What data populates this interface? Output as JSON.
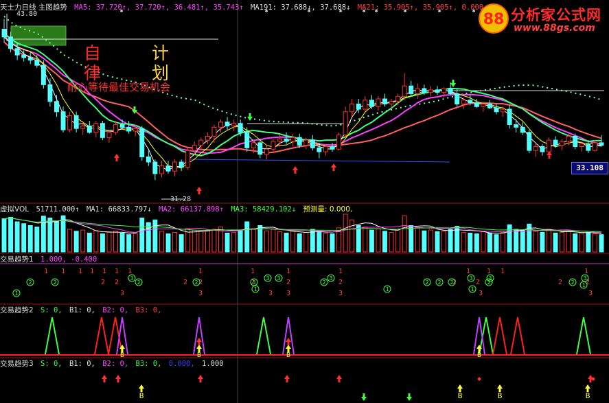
{
  "header_main": {
    "title": "天士力日线  主图趋势",
    "ma5": "MA5: 37.720↑, 37.720↑, 36.481↑, 35.743↑",
    "ma191": "MA191: 37.688↓, 37.688↓",
    "ma21": "MA21: 35.905↑, 35.905↑, 0.000,"
  },
  "price": {
    "high_label": "43.80",
    "low_label": "31.28",
    "last_tag": "33.108"
  },
  "annotations": {
    "zi_lv": [
      "自",
      "律"
    ],
    "ji_hua": [
      "计",
      "划"
    ],
    "note": "耐心等待最佳交易机会"
  },
  "logo": {
    "name": "分析家公式网",
    "url": "www.88gs.com"
  },
  "header_vol": {
    "title": "虚拟VOL",
    "vol": "51711.000↑",
    "ma1": "MA1: 66833.797↓",
    "ma2": "MA2: 66137.898↑",
    "ma3": "MA3: 58429.102↓",
    "pred": "预测量: 0.000,"
  },
  "header_t1": {
    "title": "交易趋势1",
    "values": "1.000, -0.400"
  },
  "header_t2": {
    "title": "交易趋势2",
    "s": "S: 0,",
    "b1": "B1: 0,",
    "b2": "B2: 0,",
    "b3": "B3: 0,"
  },
  "header_t3": {
    "title": "交易趋势3",
    "s": "S: 0,",
    "b1": "B1: 0,",
    "b2": "B2: 0,",
    "b3": "B3: 0,",
    "extra1": "0.000,",
    "extra2": "1.000"
  },
  "colors": {
    "up": "#ff3030",
    "down": "#54ffff",
    "ma_fast": "#ffffff",
    "ma_mid": "#ffff00",
    "ma_slow": "#ff40ff",
    "ma_green": "#40ff80",
    "ma_orange": "#ff6060",
    "dotted": "#80ffb0"
  },
  "candles": [
    [
      43.0,
      43.8,
      42.0,
      42.4
    ],
    [
      42.4,
      42.8,
      41.2,
      41.5
    ],
    [
      41.5,
      42.0,
      40.6,
      41.0
    ],
    [
      41.0,
      41.5,
      40.5,
      40.8
    ],
    [
      40.8,
      41.3,
      40.3,
      40.6
    ],
    [
      40.6,
      41.0,
      40.0,
      40.2
    ],
    [
      40.2,
      40.6,
      38.4,
      38.7
    ],
    [
      38.7,
      39.2,
      37.0,
      37.4
    ],
    [
      37.4,
      37.9,
      36.2,
      36.6
    ],
    [
      36.6,
      37.0,
      35.0,
      35.2
    ],
    [
      35.2,
      36.6,
      35.0,
      36.3
    ],
    [
      36.3,
      36.6,
      35.0,
      35.3
    ],
    [
      35.3,
      35.9,
      34.8,
      35.5
    ],
    [
      35.5,
      35.9,
      34.9,
      35.0
    ],
    [
      35.0,
      35.9,
      34.6,
      35.7
    ],
    [
      35.7,
      35.9,
      34.4,
      34.6
    ],
    [
      34.6,
      35.2,
      34.2,
      35.0
    ],
    [
      35.0,
      35.9,
      34.8,
      35.6
    ],
    [
      35.6,
      36.0,
      35.2,
      35.4
    ],
    [
      35.4,
      35.9,
      34.9,
      35.1
    ],
    [
      35.1,
      35.6,
      34.7,
      35.3
    ],
    [
      35.3,
      35.5,
      32.8,
      33.1
    ],
    [
      33.1,
      33.6,
      32.4,
      32.7
    ],
    [
      32.7,
      32.9,
      31.3,
      31.8
    ],
    [
      31.8,
      32.8,
      31.5,
      32.4
    ],
    [
      32.4,
      32.8,
      31.8,
      32.0
    ],
    [
      32.0,
      32.9,
      31.6,
      32.7
    ],
    [
      32.7,
      32.9,
      32.0,
      32.3
    ],
    [
      32.3,
      33.8,
      32.1,
      33.6
    ],
    [
      33.6,
      34.3,
      33.2,
      34.0
    ],
    [
      34.0,
      34.6,
      33.6,
      34.4
    ],
    [
      34.4,
      35.0,
      34.1,
      34.7
    ],
    [
      34.7,
      35.6,
      34.2,
      35.4
    ],
    [
      35.4,
      36.0,
      35.0,
      35.8
    ],
    [
      35.8,
      36.2,
      35.2,
      35.5
    ],
    [
      35.5,
      36.0,
      35.1,
      35.7
    ],
    [
      35.7,
      36.0,
      34.7,
      35.0
    ],
    [
      35.0,
      35.4,
      33.5,
      33.8
    ],
    [
      33.8,
      34.4,
      33.4,
      34.2
    ],
    [
      34.2,
      34.5,
      33.0,
      33.3
    ],
    [
      33.3,
      34.0,
      32.9,
      33.7
    ],
    [
      33.7,
      34.5,
      33.5,
      34.3
    ],
    [
      34.3,
      34.8,
      33.9,
      34.5
    ],
    [
      34.5,
      35.0,
      34.1,
      34.3
    ],
    [
      34.3,
      34.9,
      33.9,
      34.6
    ],
    [
      34.6,
      34.9,
      33.8,
      34.0
    ],
    [
      34.0,
      34.6,
      33.7,
      34.4
    ],
    [
      34.4,
      34.8,
      33.6,
      33.8
    ],
    [
      33.8,
      34.2,
      33.0,
      33.5
    ],
    [
      33.5,
      34.0,
      33.2,
      33.9
    ],
    [
      33.9,
      34.2,
      33.5,
      33.7
    ],
    [
      33.7,
      35.0,
      33.6,
      34.8
    ],
    [
      34.8,
      37.0,
      34.6,
      36.6
    ],
    [
      36.6,
      37.6,
      36.2,
      37.2
    ],
    [
      37.2,
      37.6,
      36.5,
      36.8
    ],
    [
      36.8,
      37.8,
      36.6,
      37.5
    ],
    [
      37.5,
      37.9,
      36.8,
      37.0
    ],
    [
      37.0,
      37.8,
      36.7,
      37.6
    ],
    [
      37.6,
      38.0,
      37.0,
      37.2
    ],
    [
      37.2,
      37.6,
      36.8,
      37.4
    ],
    [
      37.4,
      38.0,
      37.1,
      37.8
    ],
    [
      37.8,
      39.6,
      37.5,
      38.6
    ],
    [
      38.6,
      39.0,
      37.8,
      38.0
    ],
    [
      38.0,
      38.8,
      37.6,
      38.4
    ],
    [
      38.4,
      38.7,
      37.9,
      38.1
    ],
    [
      38.1,
      38.6,
      37.8,
      38.3
    ],
    [
      38.3,
      38.6,
      37.9,
      38.1
    ],
    [
      38.1,
      38.5,
      37.7,
      38.4
    ],
    [
      38.4,
      38.9,
      37.9,
      38.0
    ],
    [
      38.0,
      38.4,
      37.0,
      37.2
    ],
    [
      37.2,
      37.7,
      36.8,
      37.5
    ],
    [
      37.5,
      37.9,
      37.1,
      37.3
    ],
    [
      37.3,
      37.6,
      36.9,
      37.0
    ],
    [
      37.0,
      37.4,
      36.6,
      37.2
    ],
    [
      37.2,
      37.5,
      36.8,
      36.9
    ],
    [
      36.9,
      37.2,
      36.4,
      36.6
    ],
    [
      36.6,
      37.0,
      36.2,
      36.8
    ],
    [
      36.8,
      37.1,
      35.3,
      35.6
    ],
    [
      35.6,
      36.0,
      35.0,
      35.4
    ],
    [
      35.4,
      35.8,
      34.8,
      35.0
    ],
    [
      35.0,
      35.2,
      33.4,
      33.6
    ],
    [
      33.6,
      34.2,
      33.1,
      33.9
    ],
    [
      33.9,
      34.1,
      33.2,
      33.5
    ],
    [
      33.5,
      34.6,
      33.4,
      34.4
    ],
    [
      34.4,
      34.7,
      33.8,
      34.0
    ],
    [
      34.0,
      34.5,
      33.6,
      34.3
    ],
    [
      34.3,
      34.9,
      34.0,
      34.7
    ],
    [
      34.7,
      34.9,
      33.7,
      33.9
    ],
    [
      33.9,
      34.3,
      33.5,
      34.1
    ],
    [
      34.1,
      34.4,
      33.4,
      33.6
    ],
    [
      33.6,
      34.4,
      33.5,
      34.2
    ],
    [
      34.2,
      34.8,
      33.9,
      34.0
    ]
  ],
  "volumes": [
    88,
    92,
    80,
    75,
    70,
    66,
    95,
    90,
    82,
    96,
    60,
    55,
    58,
    50,
    57,
    48,
    52,
    55,
    50,
    46,
    49,
    90,
    78,
    85,
    55,
    48,
    52,
    46,
    62,
    58,
    55,
    57,
    60,
    66,
    50,
    52,
    58,
    80,
    62,
    70,
    56,
    60,
    54,
    50,
    55,
    48,
    52,
    60,
    54,
    50,
    48,
    64,
    100,
    85,
    70,
    66,
    58,
    62,
    55,
    52,
    60,
    96,
    70,
    64,
    56,
    58,
    54,
    55,
    60,
    68,
    52,
    50,
    48,
    54,
    50,
    46,
    52,
    72,
    60,
    58,
    74,
    54,
    52,
    60,
    50,
    52,
    56,
    48,
    50,
    52,
    48,
    46
  ]
}
